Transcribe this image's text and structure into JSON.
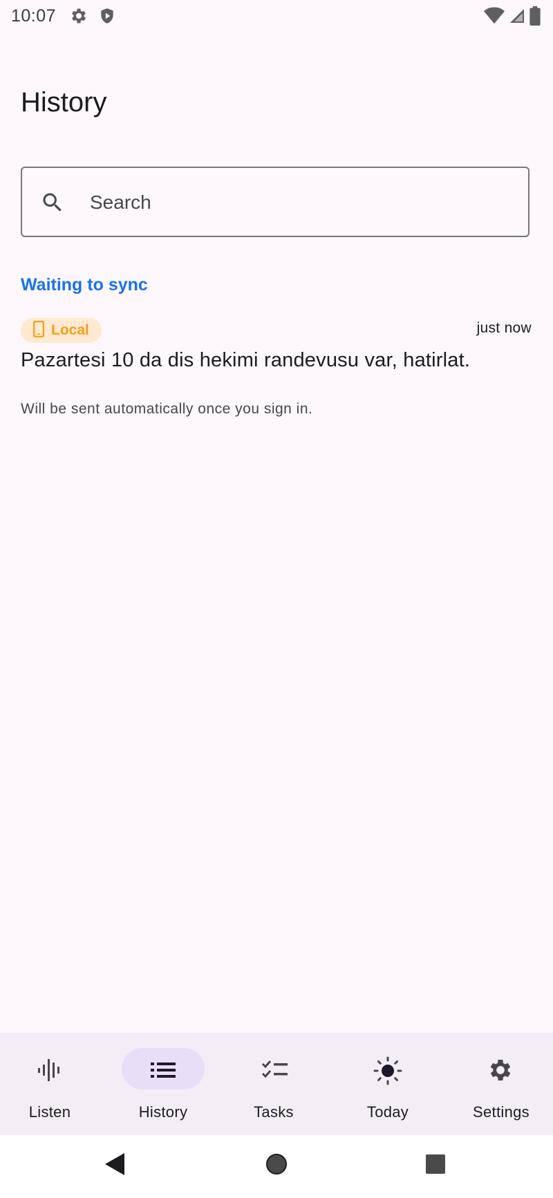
{
  "status_bar": {
    "time": "10:07",
    "icons": [
      "gear-icon",
      "shield-icon",
      "wifi-icon",
      "signal-icon",
      "battery-icon"
    ]
  },
  "page": {
    "title": "History"
  },
  "search": {
    "placeholder": "Search",
    "value": "",
    "icon": "search-icon"
  },
  "section": {
    "title": "Waiting to sync"
  },
  "history_items": [
    {
      "badge_label": "Local",
      "badge_icon": "phone-icon",
      "time": "just now",
      "text": "Pazartesi 10 da dis hekimi randevusu var, hatirlat.",
      "note": "Will be sent automatically once you sign in."
    }
  ],
  "bottom_nav": {
    "items": [
      {
        "label": "Listen",
        "icon": "waveform-icon",
        "active": false
      },
      {
        "label": "History",
        "icon": "list-icon",
        "active": true
      },
      {
        "label": "Tasks",
        "icon": "checklist-icon",
        "active": false
      },
      {
        "label": "Today",
        "icon": "sun-icon",
        "active": false
      },
      {
        "label": "Settings",
        "icon": "gear-icon",
        "active": false
      }
    ]
  },
  "system_nav": {
    "buttons": [
      "back-icon",
      "home-icon",
      "recents-icon"
    ]
  },
  "colors": {
    "background": "#fef7fc",
    "accent_blue": "#1a73e8",
    "badge_bg": "#ffe9d0",
    "badge_text": "#f59f1a",
    "nav_bg": "#f3eef6",
    "nav_active_pill": "#e8def8"
  }
}
